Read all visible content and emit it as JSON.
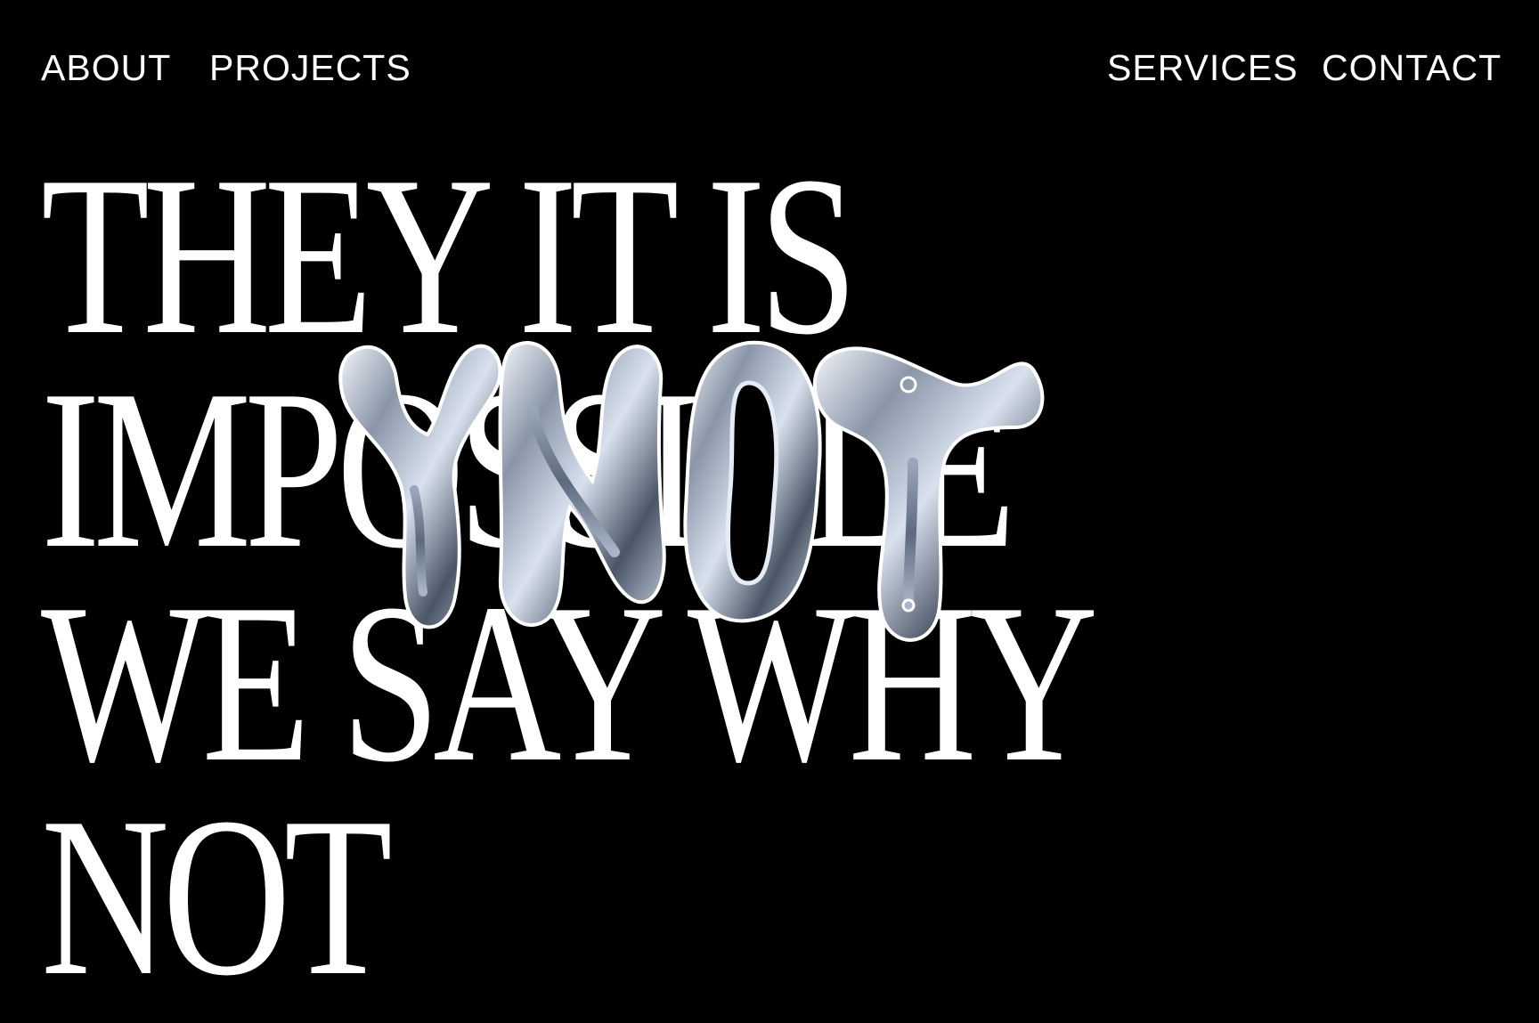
{
  "nav": {
    "about": "ABOUT",
    "projects": "PROJECTS",
    "services": "SERVICES",
    "contact": "CONTACT"
  },
  "hero": {
    "lines": [
      "THEY IT IS",
      "IMPOSSIBLE",
      "WE SAY WHY",
      "NOT"
    ],
    "overlay_word": "YNOT"
  },
  "colors": {
    "background": "#000000",
    "text": "#ffffff",
    "chrome_dark": "#4a5566",
    "chrome_light": "#e6ecf5"
  }
}
